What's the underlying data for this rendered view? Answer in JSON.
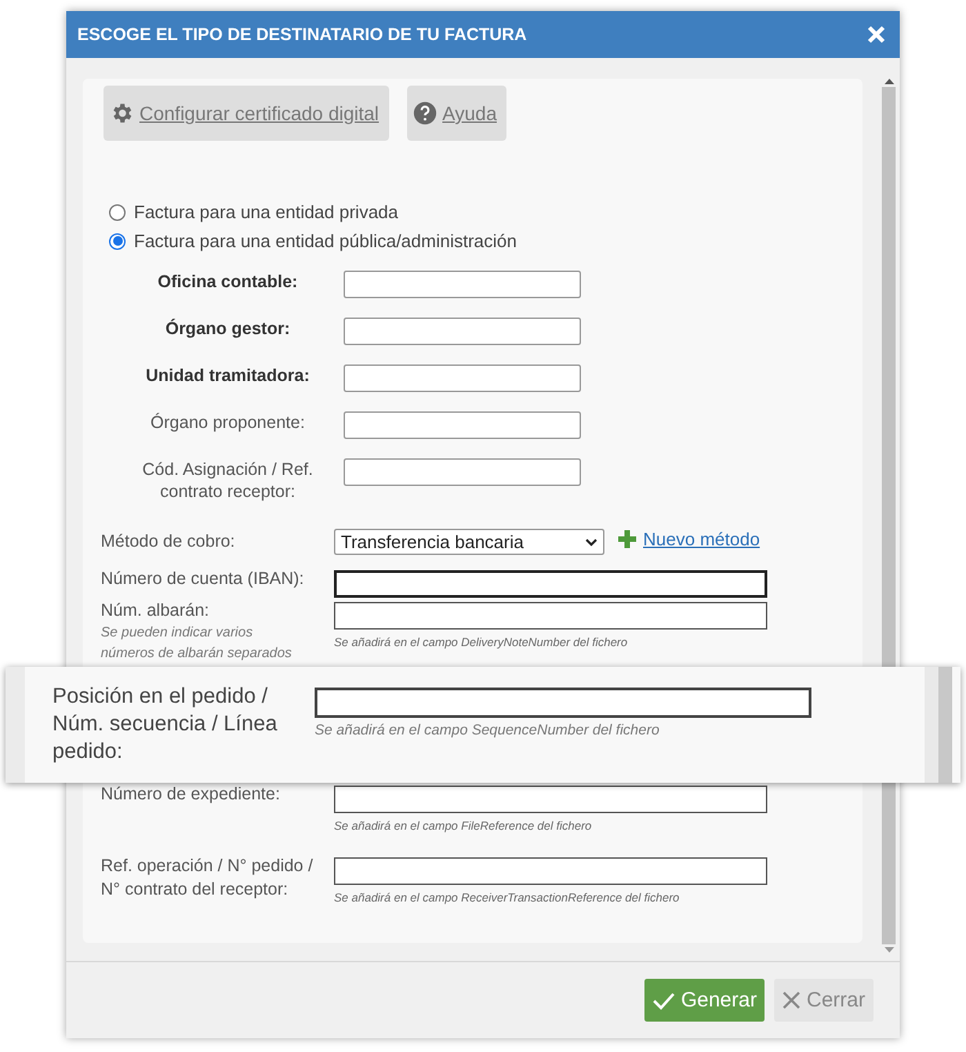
{
  "dialog": {
    "title": "ESCOGE EL TIPO DE DESTINATARIO DE TU FACTURA"
  },
  "toolbar": [
    {
      "kind": "settings",
      "label": "Configurar certificado digital"
    },
    {
      "kind": "help",
      "label": "Ayuda"
    }
  ],
  "recipient_options": [
    {
      "label": "Factura para una entidad privada",
      "selected": false
    },
    {
      "label": "Factura para una entidad pública/administración",
      "selected": true
    }
  ],
  "public_fields": [
    {
      "label": "Oficina contable:",
      "bold": true
    },
    {
      "label": "Órgano gestor:",
      "bold": true
    },
    {
      "label": "Unidad tramitadora:",
      "bold": true
    },
    {
      "label": "Órgano proponente:",
      "bold": false
    },
    {
      "label": "Cód. Asignación / Ref. contrato receptor:",
      "bold": false
    }
  ],
  "payment": {
    "label": "Método de cobro:",
    "value": "Transferencia bancaria",
    "new_link": "Nuevo método"
  },
  "fields": [
    {
      "label": "Número de cuenta (IBAN):",
      "focused": true
    },
    {
      "label": "Núm. albarán:",
      "note": "Se pueden indicar varios números de albarán separados",
      "hint": "Se añadirá en el campo DeliveryNoteNumber del fichero",
      "focused": false
    },
    {
      "label": "Número de expediente:",
      "hint": "Se añadirá en el campo FileReference del fichero",
      "focused": false
    },
    {
      "label": "Ref. operación / N° pedido / N° contrato del receptor:",
      "hint": "Se añadirá en el campo ReceiverTransactionReference del fichero",
      "focused": false
    }
  ],
  "zoom_callout": {
    "label": "Posición en el pedido / Núm. secuencia / Línea pedido:",
    "hint": "Se añadirá en el campo SequenceNumber del fichero"
  },
  "footer": [
    {
      "kind": "primary",
      "label": "Generar"
    },
    {
      "kind": "secondary",
      "label": "Cerrar"
    }
  ]
}
